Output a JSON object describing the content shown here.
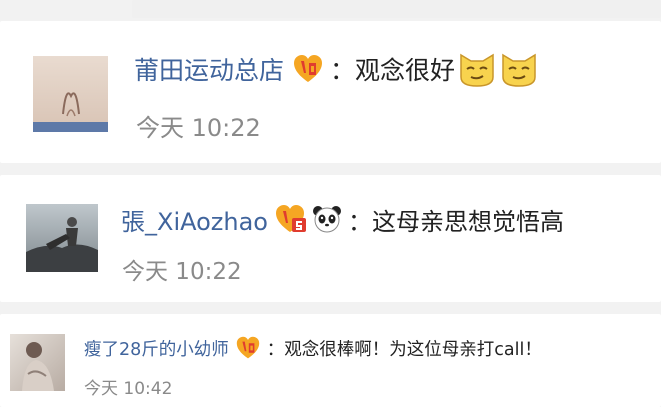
{
  "comments": [
    {
      "username": "莆田运动总店",
      "separator": "：",
      "message": "观念很好",
      "time": "今天 10:22",
      "badge_icon": "vip-level-badge-icon",
      "emoji_icons": [
        "smug-cat-emoji-icon",
        "smug-cat-emoji-icon"
      ]
    },
    {
      "username": "張_XiAozhao",
      "separator": "：",
      "message": "这母亲思想觉悟高",
      "time": "今天 10:22",
      "badge_icon": "vip-level-badge-icon",
      "emoji_icons": [
        "panda-emoji-icon"
      ]
    },
    {
      "username": "瘦了28斤的小幼师",
      "separator": "：",
      "message": "观念很棒啊！为这位母亲打call！",
      "time": "今天 10:42",
      "badge_icon": "vip-level-badge-icon",
      "emoji_icons": []
    }
  ],
  "colors": {
    "username": "#40649c",
    "message": "#222222",
    "time": "#8a8a8a",
    "background": "#f2f2f2",
    "card": "#ffffff",
    "badge": "#f5a623"
  }
}
